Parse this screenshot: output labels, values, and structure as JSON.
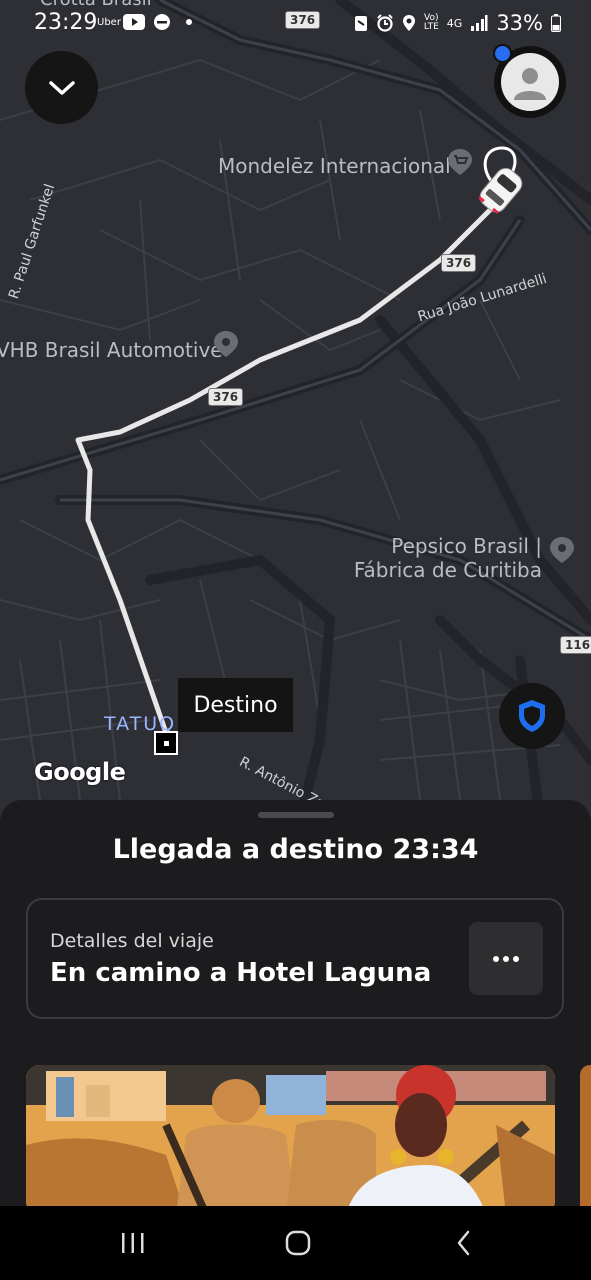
{
  "status_bar": {
    "time": "23:29",
    "app_label": "Uber",
    "lte_top": "Vo)",
    "lte_bottom": "LTE",
    "network": "4G",
    "battery": "33%",
    "icons": [
      "youtube-icon",
      "minus-circle-icon",
      "dot-icon",
      "nfc-icon",
      "alarm-icon",
      "location-icon",
      "signal-icon",
      "battery-icon"
    ]
  },
  "map": {
    "pois": [
      {
        "name": "Mondelēz Internacional",
        "icon": "shopping-cart-pin-icon"
      },
      {
        "name": "VHB Brasil Automotive",
        "icon": "map-pin-icon"
      },
      {
        "name_line1": "Pepsico Brasil |",
        "name_line2": "Fábrica de Curitiba",
        "icon": "map-pin-icon"
      },
      {
        "name": "Crotta Brasil"
      }
    ],
    "streets": [
      "R. Paul Garfunkel",
      "Rua João Lunardelli",
      "R. Antônio Za"
    ],
    "route_shields": [
      "376",
      "376",
      "376",
      "116"
    ],
    "neighborhood": "TATUQ",
    "destination_label": "Destino",
    "attribution": "Google"
  },
  "sheet": {
    "arrival_text": "Llegada a destino 23:34",
    "trip_details_label": "Detalles del viaje",
    "trip_status": "En camino a Hotel Laguna"
  },
  "colors": {
    "accent_blue": "#276ef1",
    "shield_blue": "#1f6ef0",
    "sheet_bg": "#1c1c1e",
    "map_bg": "#2d2f35"
  }
}
